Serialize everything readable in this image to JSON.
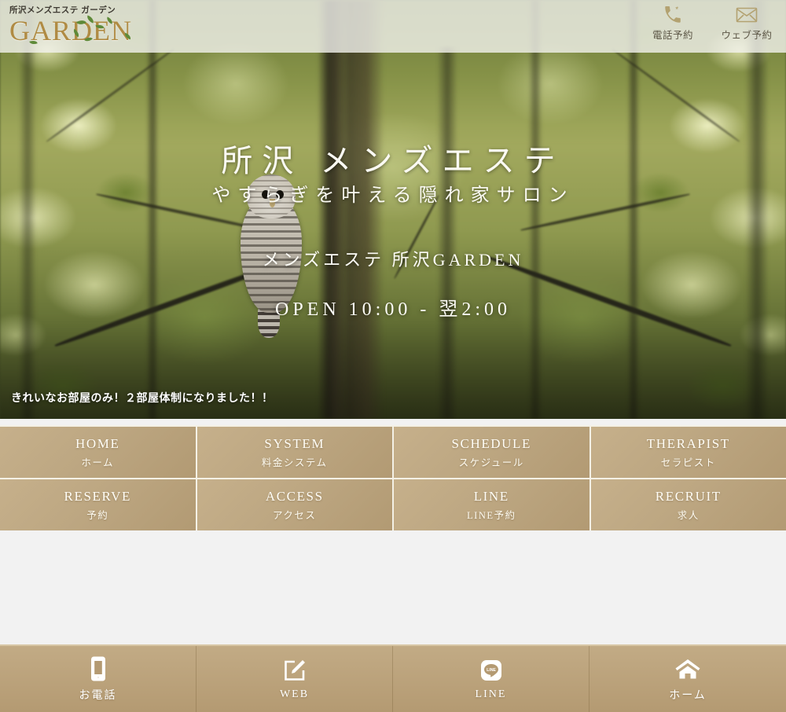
{
  "header": {
    "logo_kana": "所沢メンズエステ ガーデン",
    "logo_main": "GARDEN",
    "actions": [
      {
        "icon": "phone-icon",
        "label": "電話予約"
      },
      {
        "icon": "envelope-icon",
        "label": "ウェブ予約"
      }
    ]
  },
  "hero": {
    "title": "所沢 メンズエステ",
    "subtitle": "やすらぎを叶える隠れ家サロン",
    "shop_name": "メンズエステ 所沢GARDEN",
    "open_hours": "OPEN 10:00 - 翌2:00",
    "ticker": "きれいなお部屋のみ！２部屋体制になりました！！"
  },
  "nav": {
    "items": [
      {
        "en": "HOME",
        "jp": "ホーム"
      },
      {
        "en": "SYSTEM",
        "jp": "料金システム"
      },
      {
        "en": "SCHEDULE",
        "jp": "スケジュール"
      },
      {
        "en": "THERAPIST",
        "jp": "セラピスト"
      },
      {
        "en": "RESERVE",
        "jp": "予約"
      },
      {
        "en": "ACCESS",
        "jp": "アクセス"
      },
      {
        "en": "LINE",
        "jp": "LINE予約"
      },
      {
        "en": "RECRUIT",
        "jp": "求人"
      }
    ]
  },
  "bottombar": {
    "items": [
      {
        "icon": "smartphone-icon",
        "label": "お電話"
      },
      {
        "icon": "compose-pencil-icon",
        "label": "WEB"
      },
      {
        "icon": "line-app-icon",
        "label": "LINE"
      },
      {
        "icon": "house-icon",
        "label": "ホーム"
      }
    ]
  },
  "colors": {
    "gold": "#b08b43",
    "tile": "#bda782",
    "tile_border": "#f4f1e6",
    "bottom_bar": "#b49a72",
    "page_bg": "#f2f2f2",
    "header_bg": "#f3f3ee"
  }
}
